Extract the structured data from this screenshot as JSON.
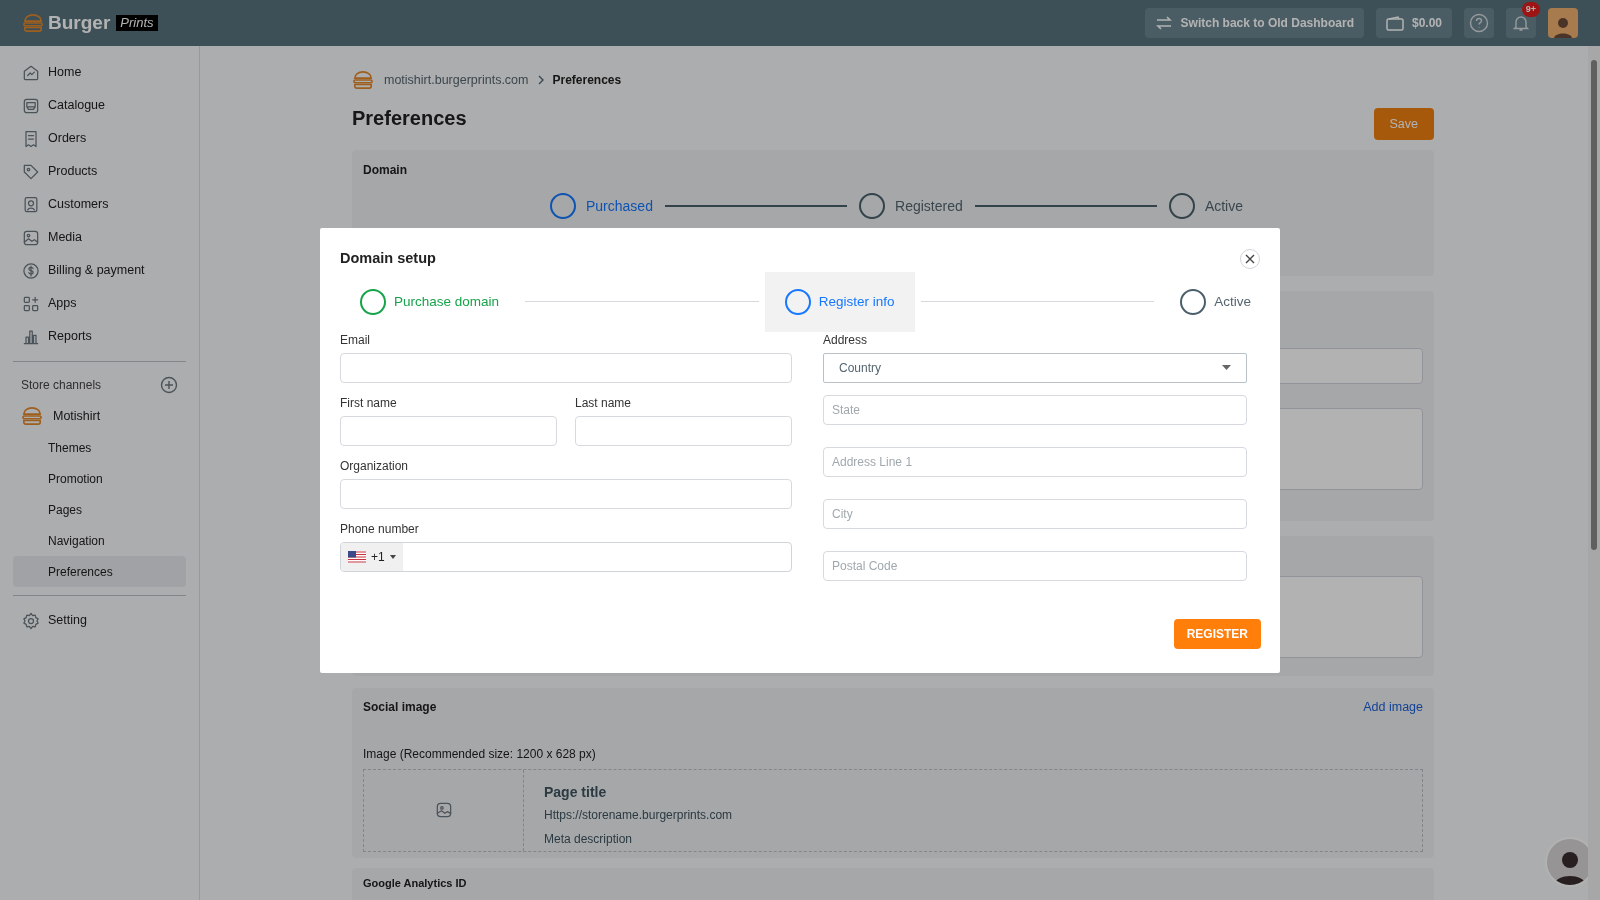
{
  "topbar": {
    "logo_word": "Burger",
    "logo_tag": "Prints",
    "switch_button": "Switch back to Old Dashboard",
    "balance": "$0.00",
    "notification_badge": "9+"
  },
  "sidebar": {
    "items": [
      {
        "label": "Home",
        "kind": "home"
      },
      {
        "label": "Catalogue",
        "kind": "catalogue"
      },
      {
        "label": "Orders",
        "kind": "orders"
      },
      {
        "label": "Products",
        "kind": "tag"
      },
      {
        "label": "Customers",
        "kind": "person"
      },
      {
        "label": "Media",
        "kind": "image"
      },
      {
        "label": "Billing & payment",
        "kind": "dollar"
      },
      {
        "label": "Apps",
        "kind": "apps"
      },
      {
        "label": "Reports",
        "kind": "chart"
      }
    ],
    "store_channels_label": "Store channels",
    "store": "Motishirt",
    "store_items": [
      {
        "label": "Themes",
        "selected": false
      },
      {
        "label": "Promotion",
        "selected": false
      },
      {
        "label": "Pages",
        "selected": false
      },
      {
        "label": "Navigation",
        "selected": false
      },
      {
        "label": "Preferences",
        "selected": true
      }
    ],
    "setting": "Setting"
  },
  "breadcrumb": [
    "motishirt.burgerprints.com",
    "Preferences"
  ],
  "page_title": "Preferences",
  "save_button": "Save",
  "domain_card": {
    "title": "Domain",
    "steps": [
      {
        "label": "Purchased",
        "kind": "current"
      },
      {
        "label": "Registered",
        "kind": "pending"
      },
      {
        "label": "Active",
        "kind": "pending"
      }
    ]
  },
  "social_image_card": {
    "title": "Social image",
    "add_link": "Add image",
    "image_label": "Image (Recommended size: 1200 x 628 px)",
    "preview_title": "Page title",
    "preview_url": "Https://storename.burgerprints.com",
    "preview_description": "Meta description"
  },
  "next_card_title": "Google Analytics ID",
  "modal": {
    "title": "Domain setup",
    "steps": [
      {
        "label": "Purchase domain",
        "kind": "done",
        "selected": false
      },
      {
        "label": "Register info",
        "kind": "current",
        "selected": true
      },
      {
        "label": "Active",
        "kind": "pending",
        "selected": false
      }
    ],
    "email_label": "Email",
    "first_name_label": "First name",
    "last_name_label": "Last name",
    "organization_label": "Organization",
    "phone_label": "Phone number",
    "phone_code": "+1",
    "address_label": "Address",
    "country_placeholder": "Country",
    "address_fields": [
      {
        "placeholder": "State"
      },
      {
        "placeholder": "Address Line 1"
      },
      {
        "placeholder": "City"
      },
      {
        "placeholder": "Postal Code"
      }
    ],
    "register_button": "REGISTER"
  }
}
